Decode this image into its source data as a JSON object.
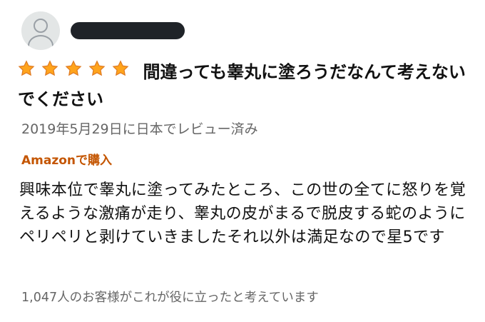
{
  "review": {
    "rating": 5,
    "rating_max": 5,
    "title": "間違っても睾丸に塗ろうだなんて考えないでください",
    "date": "2019年5月29日に日本でレビュー済み",
    "verified": "Amazonで購入",
    "body": "興味本位で睾丸に塗ってみたところ、この世の全てに怒りを覚えるような激痛が走り、睾丸の皮がまるで脱皮する蛇のようにペリペリと剥けていきましたそれ以外は満足なので星5です",
    "helpful": "1,047人のお客様がこれが役に立ったと考えています"
  },
  "colors": {
    "star": "#ffa41c",
    "star_outline": "#de7921",
    "verified": "#c45500",
    "muted": "#666666",
    "redaction": "#1f2328"
  },
  "icons": {
    "avatar": "user-avatar-icon",
    "star": "star-icon"
  }
}
